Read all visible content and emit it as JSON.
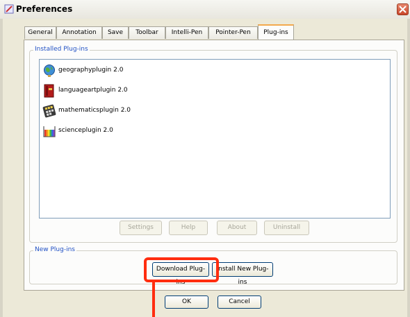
{
  "window": {
    "title": "Preferences"
  },
  "tabs": [
    "General",
    "Annotation",
    "Save",
    "Toolbar",
    "Intelli-Pen",
    "Pointer-Pen",
    "Plug-ins"
  ],
  "active_tab": "Plug-ins",
  "installed": {
    "title": "Installed Plug-ins",
    "items": [
      {
        "label": "geographyplugin 2.0",
        "icon": "globe-icon"
      },
      {
        "label": "languageartplugin 2.0",
        "icon": "book-icon"
      },
      {
        "label": "mathematicsplugin 2.0",
        "icon": "calculator-icon"
      },
      {
        "label": "scienceplugin 2.0",
        "icon": "beaker-icon"
      }
    ],
    "buttons": {
      "settings": "Settings",
      "help": "Help",
      "about": "About",
      "uninstall": "Uninstall"
    }
  },
  "new_plugins": {
    "title": "New Plug-ins",
    "download": "Download Plug-ins",
    "install": "Install New Plug-ins"
  },
  "footer": {
    "ok": "OK",
    "cancel": "Cancel"
  },
  "colors": {
    "highlight": "#ff2d0f",
    "group_title": "#2151c4"
  }
}
